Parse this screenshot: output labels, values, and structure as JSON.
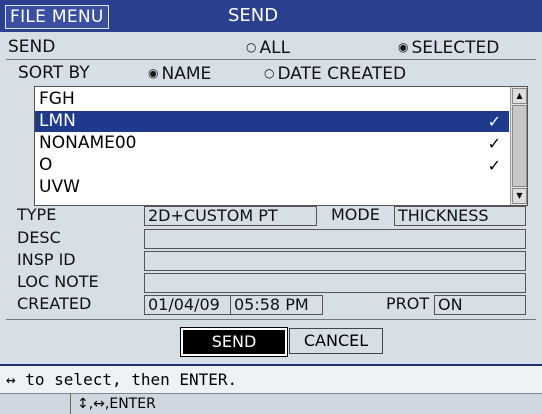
{
  "title_bar": {
    "file_menu": "FILE MENU",
    "title": "SEND"
  },
  "send_row": {
    "label": "SEND",
    "option_all": "ALL",
    "option_selected": "SELECTED",
    "selected": "SELECTED"
  },
  "sort_row": {
    "label": "SORT BY",
    "option_name": "NAME",
    "option_date": "DATE CREATED",
    "selected": "NAME"
  },
  "file_list": {
    "items": [
      {
        "name": "FGH",
        "checked": ""
      },
      {
        "name": "LMN",
        "checked": "✓"
      },
      {
        "name": "NONAME00",
        "checked": "✓"
      },
      {
        "name": "O",
        "checked": "✓"
      },
      {
        "name": "UVW",
        "checked": ""
      }
    ],
    "selected_index": 1
  },
  "details": {
    "type_label": "TYPE",
    "type_value": "2D+CUSTOM PT",
    "mode_label": "MODE",
    "mode_value": "THICKNESS",
    "desc_label": "DESC",
    "desc_value": "",
    "insp_label": "INSP ID",
    "insp_value": "",
    "loc_label": "LOC NOTE",
    "loc_value": "",
    "created_label": "CREATED",
    "created_date": "01/04/09",
    "created_time": "05:58 PM",
    "prot_label": "PROT",
    "prot_value": "ON"
  },
  "buttons": {
    "send": "SEND",
    "cancel": "CANCEL"
  },
  "help_text": "↔ to select, then ENTER.",
  "nav_hint": "↕,↔,ENTER",
  "icons": {
    "up": "scroll-up-arrow",
    "down": "scroll-down-arrow",
    "check": "checkmark"
  },
  "colors": {
    "title_bar": "#2b3f8f",
    "selection": "#1f3a8c",
    "background": "#d6dee6"
  }
}
